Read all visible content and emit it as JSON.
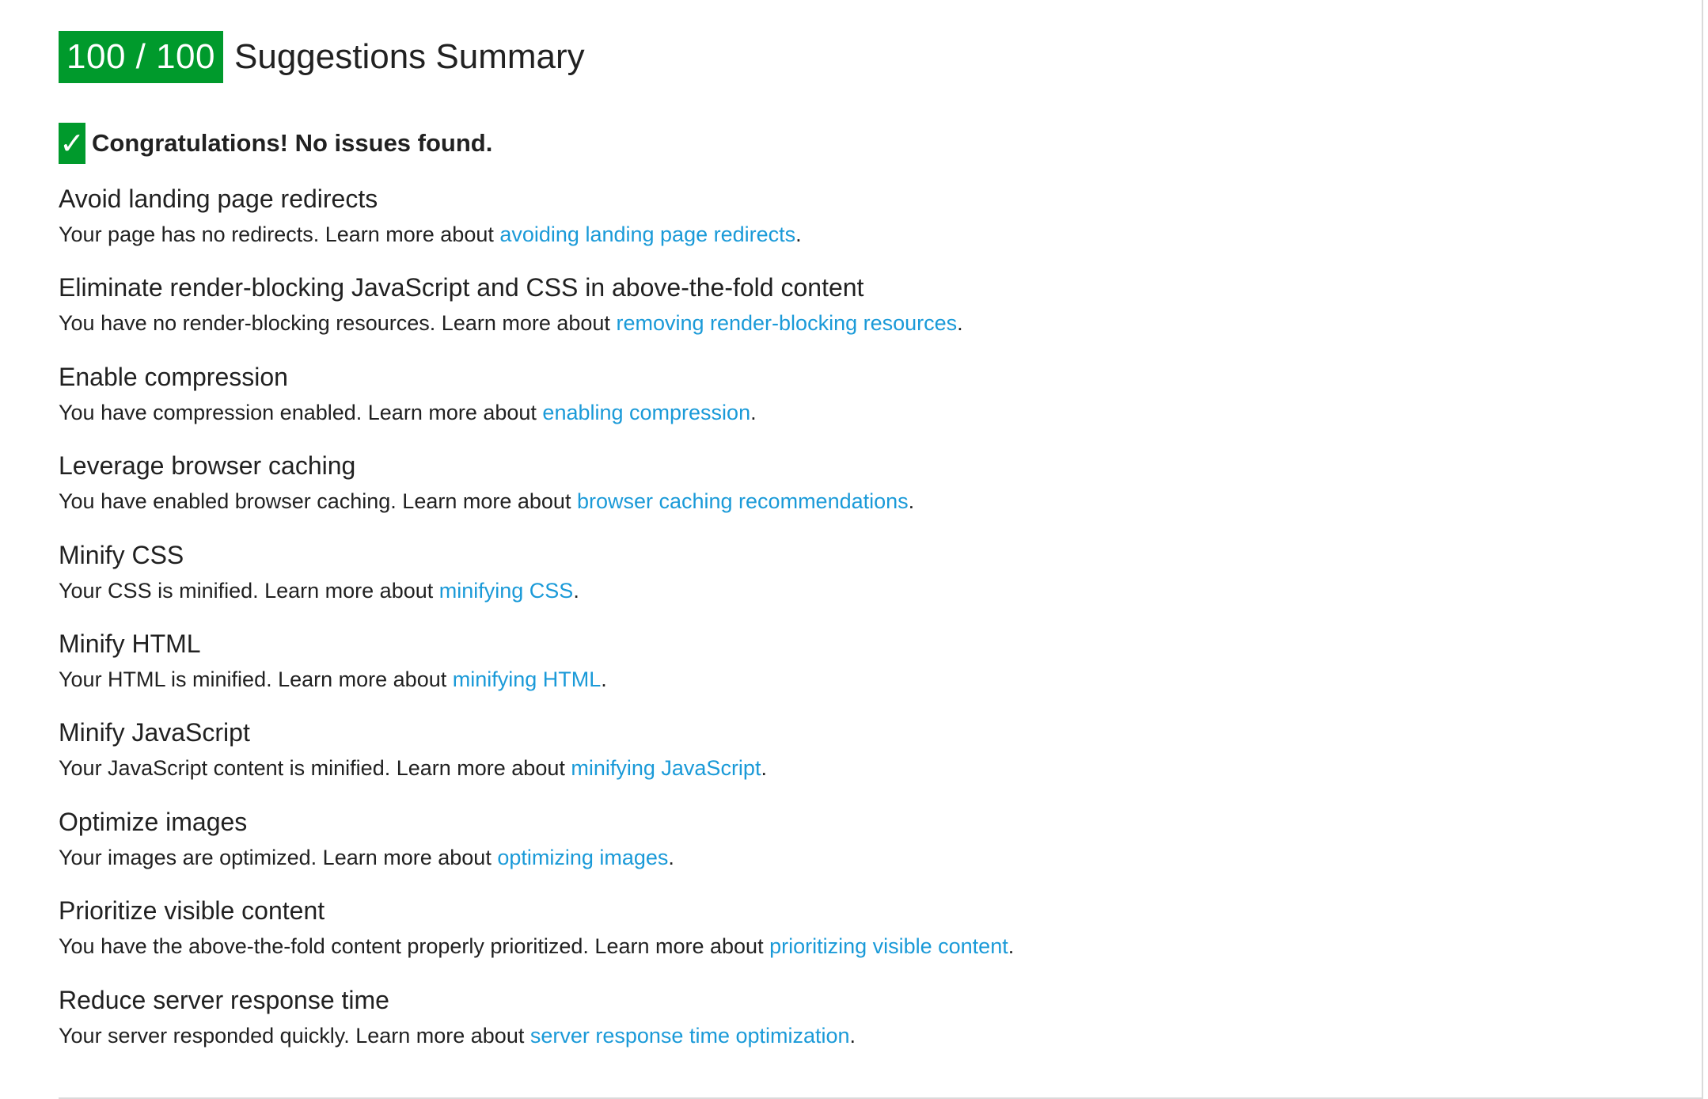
{
  "header": {
    "score": "100 / 100",
    "title": "Suggestions Summary"
  },
  "congrats": {
    "icon": "checkmark-icon",
    "text": "Congratulations! No issues found."
  },
  "colors": {
    "score_bg": "#009a2c",
    "link": "#1a9ad8",
    "text": "#212121"
  },
  "rules": [
    {
      "title": "Avoid landing page redirects",
      "desc_prefix": "Your page has no redirects. Learn more about ",
      "link": "avoiding landing page redirects",
      "suffix": "."
    },
    {
      "title": "Eliminate render-blocking JavaScript and CSS in above-the-fold content",
      "desc_prefix": "You have no render-blocking resources. Learn more about ",
      "link": "removing render-blocking resources",
      "suffix": "."
    },
    {
      "title": "Enable compression",
      "desc_prefix": "You have compression enabled. Learn more about ",
      "link": "enabling compression",
      "suffix": "."
    },
    {
      "title": "Leverage browser caching",
      "desc_prefix": "You have enabled browser caching. Learn more about ",
      "link": "browser caching recommendations",
      "suffix": "."
    },
    {
      "title": "Minify CSS",
      "desc_prefix": "Your CSS is minified. Learn more about ",
      "link": "minifying CSS",
      "suffix": "."
    },
    {
      "title": "Minify HTML",
      "desc_prefix": "Your HTML is minified. Learn more about ",
      "link": "minifying HTML",
      "suffix": "."
    },
    {
      "title": "Minify JavaScript",
      "desc_prefix": "Your JavaScript content is minified. Learn more about ",
      "link": "minifying JavaScript",
      "suffix": "."
    },
    {
      "title": "Optimize images",
      "desc_prefix": "Your images are optimized. Learn more about ",
      "link": "optimizing images",
      "suffix": "."
    },
    {
      "title": "Prioritize visible content",
      "desc_prefix": "You have the above-the-fold content properly prioritized. Learn more about ",
      "link": "prioritizing visible content",
      "suffix": "."
    },
    {
      "title": "Reduce server response time",
      "desc_prefix": "Your server responded quickly. Learn more about ",
      "link": "server response time optimization",
      "suffix": "."
    }
  ]
}
